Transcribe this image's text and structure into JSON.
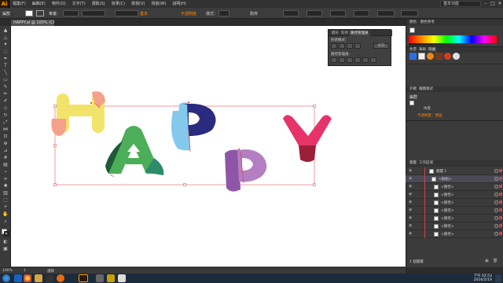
{
  "app": {
    "logo": "Ai",
    "menus": [
      "檔案(F)",
      "編輯(E)",
      "物件(O)",
      "文字(T)",
      "選取(S)",
      "效果(C)",
      "檢視(V)",
      "視窗(W)",
      "說明(H)"
    ],
    "workspace": "基本功能",
    "window_controls": [
      "–",
      "□",
      "✕"
    ]
  },
  "controlbar": {
    "selection_label": "編群",
    "stroke_label": "筆畫：",
    "brush_label": "基本",
    "opacity_label": "不透明度",
    "style_label": "樣式：",
    "align_label": "對齊"
  },
  "document": {
    "tab_title": "HAPPY.ai @ 100% (CMYK/預覽)"
  },
  "pathfinder": {
    "tabs": [
      "變形",
      "對齊",
      "路徑管理員"
    ],
    "shape_modes_label": "形狀模式：",
    "expand_label": "展開",
    "pathfinders_label": "路徑管理員："
  },
  "dock": {
    "color_tabs": [
      "顏色",
      "顏色參考"
    ],
    "swatch_tabs": [
      "色票",
      "筆刷",
      "符號"
    ],
    "appearance_tabs": [
      "外觀",
      "繪圖樣式"
    ],
    "appearance_title": "編群",
    "appearance_rows": [
      "內容",
      "不透明度：預設"
    ],
    "layers_tabs": [
      "圖層",
      "工作區域"
    ],
    "layers_footer": "1 個圖層"
  },
  "layers": [
    {
      "name": "圖層 1",
      "type": "layer"
    },
    {
      "name": "<群組>",
      "type": "group"
    },
    {
      "name": "<路徑>",
      "type": "path"
    },
    {
      "name": "<路徑>",
      "type": "path"
    },
    {
      "name": "<路徑>",
      "type": "path"
    },
    {
      "name": "<路徑>",
      "type": "path"
    },
    {
      "name": "<路徑>",
      "type": "path"
    },
    {
      "name": "<路徑>",
      "type": "path"
    },
    {
      "name": "<路徑>",
      "type": "path"
    }
  ],
  "statusbar": {
    "zoom": "100%",
    "page": "1",
    "tool": "選取"
  },
  "taskbar": {
    "time": "下午 02:53",
    "date": "2016/2/19"
  },
  "colors": {
    "h_yellow": "#f2e46a",
    "h_salmon": "#f4a08a",
    "a_dark_green": "#1e5a3a",
    "a_green": "#4cae58",
    "a_teal": "#2c8c6a",
    "p1_navy": "#2a2a7e",
    "p1_lightblue": "#84c8ec",
    "p2_purple": "#8f56a8",
    "p2_lavender": "#b47ec2",
    "y_pink": "#e6336a",
    "y_dark_red": "#9c1f3a",
    "selection": "#e05a5a"
  }
}
